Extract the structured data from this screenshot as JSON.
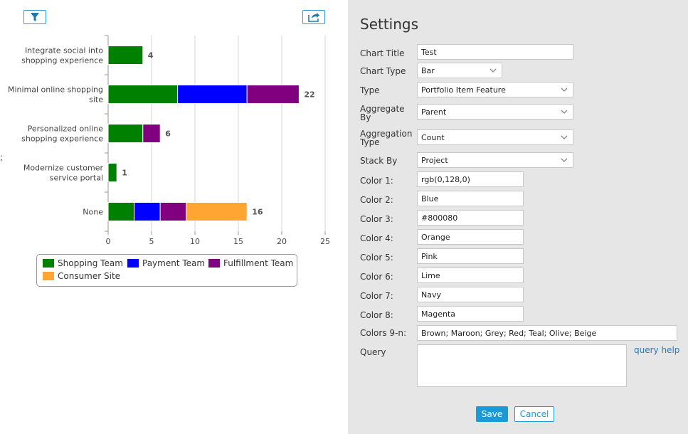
{
  "toolbar": {
    "filter_icon": "filter-icon",
    "export_icon": "export-icon"
  },
  "stray_text": ";",
  "chart_data": {
    "type": "bar",
    "orientation": "horizontal",
    "stacked": true,
    "categories": [
      [
        "Integrate social into",
        "shopping experience"
      ],
      [
        "Minimal online shopping",
        "site"
      ],
      [
        "Personalized online",
        "shopping experience"
      ],
      [
        "Modernize customer",
        "service portal"
      ],
      [
        "None"
      ]
    ],
    "series": [
      {
        "name": "Shopping Team",
        "color": "#008000",
        "values": [
          4,
          8,
          4,
          1,
          3
        ]
      },
      {
        "name": "Payment Team",
        "color": "#0000ff",
        "values": [
          0,
          8,
          0,
          0,
          3
        ]
      },
      {
        "name": "Fulfillment Team",
        "color": "#800080",
        "values": [
          0,
          6,
          2,
          0,
          3
        ]
      },
      {
        "name": "Consumer Site",
        "color": "#ffa533",
        "values": [
          0,
          0,
          0,
          0,
          7
        ]
      }
    ],
    "totals": [
      "4",
      "22",
      "6",
      "1",
      "16"
    ],
    "xlim": [
      0,
      25
    ],
    "xticks": [
      "0",
      "5",
      "10",
      "15",
      "20",
      "25"
    ],
    "grid": true,
    "legend_position": "bottom"
  },
  "legend": {
    "items": [
      {
        "label": "Shopping Team",
        "color": "#008000"
      },
      {
        "label": "Payment Team",
        "color": "#0000ff"
      },
      {
        "label": "Fulfillment Team",
        "color": "#800080"
      },
      {
        "label": "Consumer Site",
        "color": "#ffa533"
      }
    ]
  },
  "settings": {
    "title": "Settings",
    "chart_title": {
      "label": "Chart Title",
      "value": "Test"
    },
    "chart_type": {
      "label": "Chart Type",
      "value": "Bar"
    },
    "type": {
      "label": "Type",
      "value": "Portfolio Item Feature"
    },
    "aggregate_by": {
      "label": "Aggregate By",
      "value": "Parent"
    },
    "aggregation_type": {
      "label": "Aggregation Type",
      "value": "Count"
    },
    "stack_by": {
      "label": "Stack By",
      "value": "Project"
    },
    "colors": [
      {
        "label": "Color 1:",
        "value": "rgb(0,128,0)"
      },
      {
        "label": "Color 2:",
        "value": "Blue"
      },
      {
        "label": "Color 3:",
        "value": "#800080"
      },
      {
        "label": "Color 4:",
        "value": "Orange"
      },
      {
        "label": "Color 5:",
        "value": "Pink"
      },
      {
        "label": "Color 6:",
        "value": "Lime"
      },
      {
        "label": "Color 7:",
        "value": "Navy"
      },
      {
        "label": "Color 8:",
        "value": "Magenta"
      }
    ],
    "colors_9n": {
      "label": "Colors 9-n:",
      "value": "Brown; Maroon; Grey; Red; Teal; Olive; Beige"
    },
    "query": {
      "label": "Query",
      "value": "",
      "help": "query help"
    },
    "save_label": "Save",
    "cancel_label": "Cancel"
  }
}
